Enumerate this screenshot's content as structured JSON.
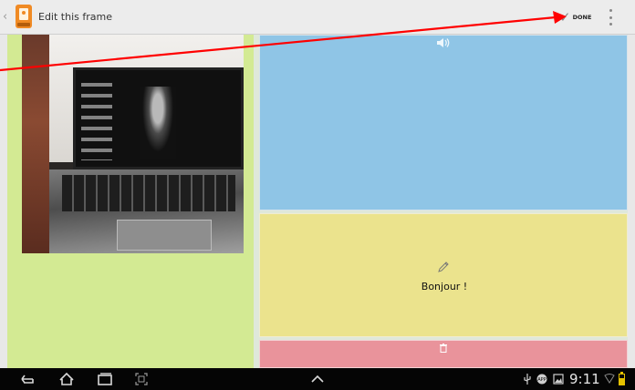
{
  "action_bar": {
    "title": "Edit this frame",
    "done_label": "DONE",
    "icons": [
      "back-chevron-icon",
      "app-frame-icon",
      "check-icon",
      "overflow-menu-icon"
    ]
  },
  "frames": {
    "image_frame": {
      "color": "#d3ea93",
      "content": "photo"
    },
    "audio_frame": {
      "color": "#8fc5e6",
      "icon": "speaker-icon"
    },
    "text_frame": {
      "color": "#ebe38d",
      "icon": "pencil-icon",
      "text": "Bonjour !"
    },
    "delete_frame": {
      "color": "#e9939b",
      "icon": "trash-icon"
    }
  },
  "annotation": {
    "arrow_color": "#ff0000"
  },
  "nav_bar": {
    "buttons": [
      "back-icon",
      "home-icon",
      "recent-apps-icon",
      "screenshot-icon",
      "chevron-up-icon"
    ],
    "status": {
      "time": "9:11",
      "icons": [
        "usb-icon",
        "notification-icon",
        "gallery-icon",
        "wifi-icon",
        "battery-icon"
      ]
    }
  }
}
